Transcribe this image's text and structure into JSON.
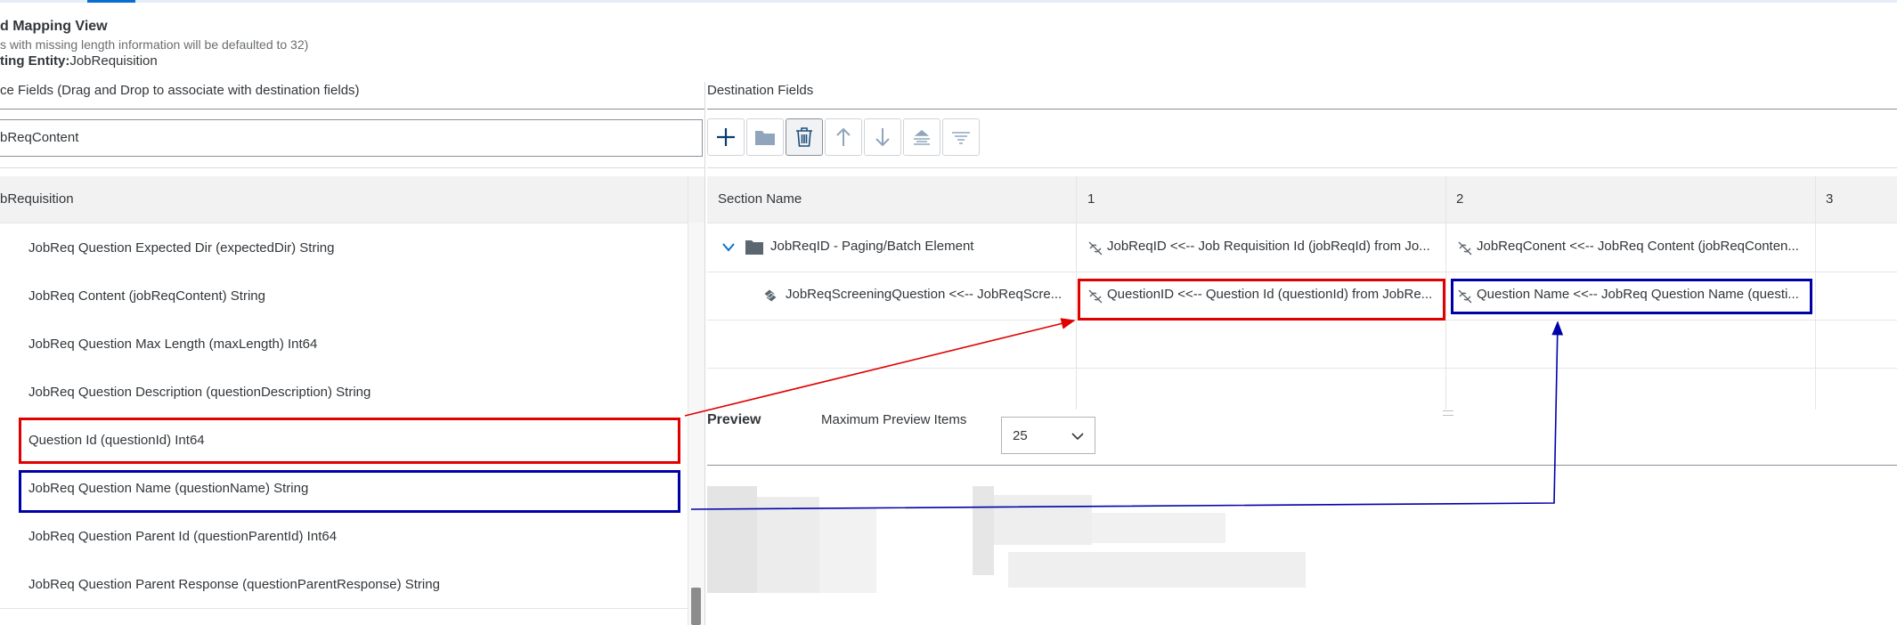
{
  "header": {
    "title": "d Mapping View",
    "note": "s with missing length information will be defaulted to 32)",
    "entity_label": "ting Entity:",
    "entity_value": "JobRequisition"
  },
  "source": {
    "section_label": "ce Fields (Drag and Drop to associate with destination fields)",
    "search_value": "bReqContent",
    "table_header": "bRequisition",
    "rows": [
      "JobReq Question Expected Dir (expectedDir) String",
      "JobReq Content (jobReqContent) String",
      "JobReq Question Max Length (maxLength) Int64",
      "JobReq Question Description (questionDescription) String",
      "Question Id (questionId) Int64",
      "JobReq Question Name (questionName) String",
      "JobReq Question Parent Id (questionParentId) Int64",
      "JobReq Question Parent Response (questionParentResponse) String"
    ]
  },
  "destination": {
    "section_label": "Destination Fields",
    "toolbar": {
      "add": "plus-icon",
      "folder": "folder-icon",
      "delete": "trash-icon",
      "up": "arrow-up-icon",
      "down": "arrow-down-icon",
      "collapse": "collapse-all-icon",
      "expand": "expand-all-icon"
    },
    "columns": [
      "Section Name",
      "1",
      "2",
      "3"
    ],
    "rows": [
      {
        "section": "JobReqID - Paging/Batch Element",
        "c1": "JobReqID <<-- Job Requisition Id (jobReqId) from Jo...",
        "c2": "JobReqConent <<-- JobReq Content (jobReqConten..."
      },
      {
        "section": "JobReqScreeningQuestion <<-- JobReqScre...",
        "c1": "QuestionID <<-- Question Id (questionId) from JobRe...",
        "c2": "Question Name <<-- JobReq Question Name (questi..."
      }
    ]
  },
  "preview": {
    "label": "Preview",
    "max_items_label": "Maximum Preview Items",
    "max_items_value": "25"
  },
  "colors": {
    "highlight_red": "#e00000",
    "highlight_blue": "#0000a8",
    "accent": "#0a6ed1"
  }
}
